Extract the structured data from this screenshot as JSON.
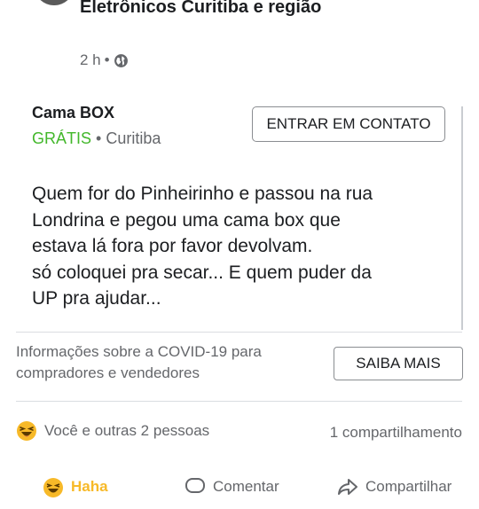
{
  "post": {
    "group_name": "Eletrônicos Curitiba e região",
    "time": "2 h",
    "separator": "•"
  },
  "listing": {
    "title": "Cama BOX",
    "price": "GRÁTIS",
    "separator": "•",
    "location": "Curitiba",
    "contact_label": "ENTRAR EM CONTATO"
  },
  "body_text": [
    "Quem for do Pinheirinho e passou na rua",
    "Londrina e pegou uma cama box que",
    "estava lá fora por favor devolvam.",
    "só coloquei  pra secar... E quem puder da",
    "UP pra ajudar..."
  ],
  "covid": {
    "text": "Informações sobre a COVID-19 para compradores e vendedores",
    "button_label": "SAIBA MAIS"
  },
  "engagement": {
    "reactions_text": "Você e outras 2 pessoas",
    "shares_text": "1 compartilhamento",
    "reaction_icon": "haha-emoji"
  },
  "actions": {
    "laugh_label": "Haha",
    "comment_label": "Comentar",
    "share_label": "Compartilhar"
  },
  "colors": {
    "price_green": "#42b72a",
    "secondary_text": "#65676b",
    "haha_yellow": "#f7b928"
  }
}
